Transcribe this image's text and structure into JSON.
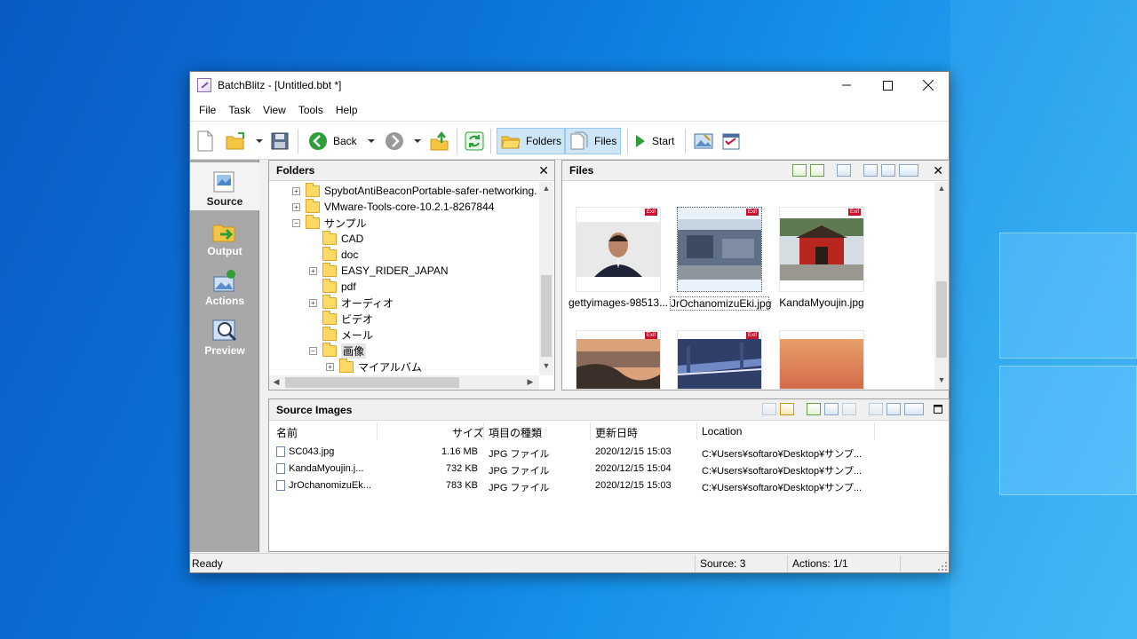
{
  "window": {
    "title": "BatchBlitz - [Untitled.bbt *]"
  },
  "menu": [
    "File",
    "Task",
    "View",
    "Tools",
    "Help"
  ],
  "toolbar": {
    "back": "Back",
    "folders": "Folders",
    "files": "Files",
    "start": "Start"
  },
  "left_nav": [
    {
      "label": "Source",
      "icon": "source-icon",
      "active": true
    },
    {
      "label": "Output",
      "icon": "output-icon",
      "active": false
    },
    {
      "label": "Actions",
      "icon": "actions-icon",
      "active": false
    },
    {
      "label": "Preview",
      "icon": "preview-icon",
      "active": false
    }
  ],
  "folders_pane": {
    "title": "Folders",
    "items": [
      {
        "label": "SpybotAntiBeaconPortable-safer-networking.",
        "level": 1,
        "exp": "+"
      },
      {
        "label": "VMware-Tools-core-10.2.1-8267844",
        "level": 1,
        "exp": "+"
      },
      {
        "label": "サンプル",
        "level": 1,
        "exp": "-"
      },
      {
        "label": "CAD",
        "level": 2,
        "exp": ""
      },
      {
        "label": "doc",
        "level": 2,
        "exp": ""
      },
      {
        "label": "EASY_RIDER_JAPAN",
        "level": 2,
        "exp": "+"
      },
      {
        "label": "pdf",
        "level": 2,
        "exp": ""
      },
      {
        "label": "オーディオ",
        "level": 2,
        "exp": "+"
      },
      {
        "label": "ビデオ",
        "level": 2,
        "exp": ""
      },
      {
        "label": "メール",
        "level": 2,
        "exp": ""
      },
      {
        "label": "画像",
        "level": 2,
        "exp": "-"
      },
      {
        "label": "マイアルバム",
        "level": 3,
        "exp": "+"
      }
    ]
  },
  "files_pane": {
    "title": "Files",
    "items": [
      {
        "name": "gettyimages-98513...",
        "exif": "Exif",
        "selected": false
      },
      {
        "name": "JrOchanomizuEki.jpg",
        "exif": "Exif",
        "selected": true
      },
      {
        "name": "KandaMyoujin.jpg",
        "exif": "Exif",
        "selected": false
      },
      {
        "name": "",
        "exif": "Exif",
        "selected": false
      },
      {
        "name": "",
        "exif": "Exif",
        "selected": false
      },
      {
        "name": "",
        "exif": "",
        "selected": false
      }
    ]
  },
  "source_images": {
    "title": "Source Images",
    "columns": [
      "名前",
      "サイズ",
      "項目の種類",
      "更新日時",
      "Location"
    ],
    "rows": [
      {
        "name": "SC043.jpg",
        "size": "1.16 MB",
        "type": "JPG ファイル",
        "date": "2020/12/15 15:03",
        "location": "C:¥Users¥softaro¥Desktop¥サンプ..."
      },
      {
        "name": "KandaMyoujin.j...",
        "size": "732 KB",
        "type": "JPG ファイル",
        "date": "2020/12/15 15:04",
        "location": "C:¥Users¥softaro¥Desktop¥サンプ..."
      },
      {
        "name": "JrOchanomizuEk...",
        "size": "783 KB",
        "type": "JPG ファイル",
        "date": "2020/12/15 15:03",
        "location": "C:¥Users¥softaro¥Desktop¥サンプ..."
      }
    ]
  },
  "status": {
    "ready": "Ready",
    "source": "Source: 3",
    "actions": "Actions: 1/1"
  }
}
